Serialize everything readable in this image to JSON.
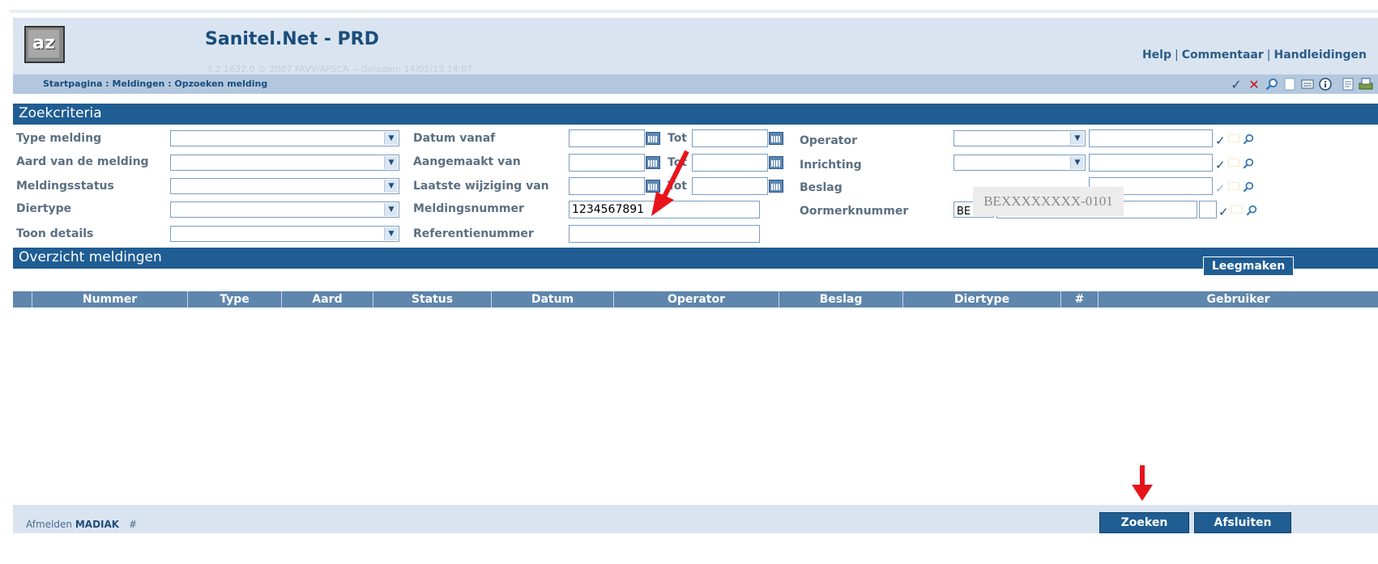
{
  "app": {
    "logo_text": "az",
    "title": "Sanitel.Net - PRD",
    "version": "3.2.1632.0 © 2007 FAVV/AFSCA -- Geladen: 14/01/13 14:07"
  },
  "header_links": {
    "help": "Help",
    "comment": "Commentaar",
    "manuals": "Handleidingen",
    "separator": "|"
  },
  "breadcrumb": "Startpagina : Meldingen : Opzoeken melding",
  "toolbar_icons": [
    "check-icon",
    "delete-icon",
    "search-icon",
    "new-document-icon",
    "form-icon",
    "info-icon",
    "document-icon",
    "print-icon"
  ],
  "search_criteria": {
    "section_title": "Zoekcriteria",
    "type_melding": {
      "label": "Type melding",
      "value": ""
    },
    "aard": {
      "label": "Aard van de melding",
      "value": ""
    },
    "status": {
      "label": "Meldingsstatus",
      "value": ""
    },
    "diertype": {
      "label": "Diertype",
      "value": ""
    },
    "toon_details": {
      "label": "Toon details",
      "value": ""
    },
    "datum_vanaf": {
      "label": "Datum vanaf",
      "from": "",
      "to": "",
      "to_label": "Tot"
    },
    "aangemaakt": {
      "label": "Aangemaakt van",
      "from": "",
      "to": "",
      "to_label": "Tot"
    },
    "laatste_wijziging": {
      "label": "Laatste wijziging van",
      "from": "",
      "to": "",
      "to_label": "Tot"
    },
    "meldingsnummer": {
      "label": "Meldingsnummer",
      "value": "1234567891"
    },
    "referentienummer": {
      "label": "Referentienummer",
      "value": ""
    },
    "operator": {
      "label": "Operator",
      "select": "",
      "value": ""
    },
    "inrichting": {
      "label": "Inrichting",
      "select": "",
      "value": ""
    },
    "beslag": {
      "label": "Beslag",
      "value": ""
    },
    "oormerk": {
      "label": "Oormerknummer",
      "country": "BE",
      "value": ""
    },
    "tooltip": "BEXXXXXXXX-0101"
  },
  "overview": {
    "section_title": "Overzicht meldingen",
    "clear_button": "Leegmaken",
    "columns": [
      "",
      "Nummer",
      "Type",
      "Aard",
      "Status",
      "Datum",
      "Operator",
      "Beslag",
      "Diertype",
      "#",
      "Gebruiker"
    ],
    "rows": []
  },
  "footer": {
    "logout_label": "Afmelden",
    "user": "MADIAK",
    "hash": "#",
    "search_button": "Zoeken",
    "close_button": "Afsluiten"
  },
  "colors": {
    "accent": "#1f5d93",
    "header_bg": "#d9e4f0",
    "annotation": "#e8141b"
  }
}
